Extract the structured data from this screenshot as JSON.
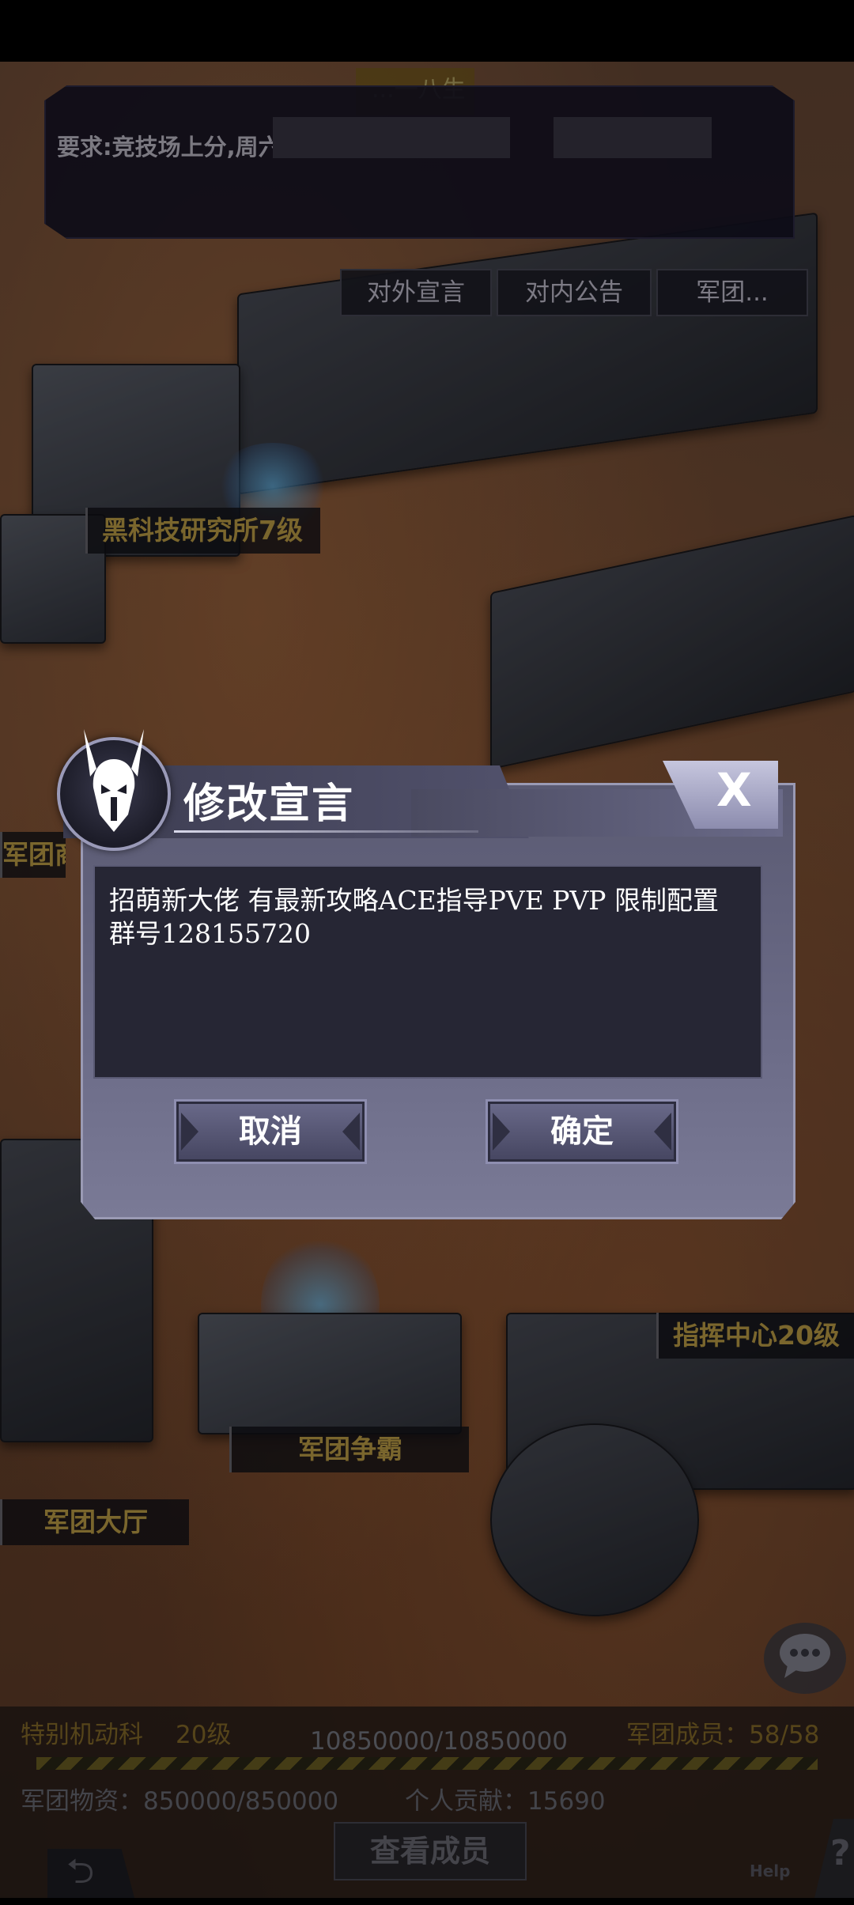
{
  "top_panel": {
    "title_fragment": "...一八生",
    "requirement": "要求:竞技场上分,周六"
  },
  "tabs": [
    "对外宣言",
    "对内公告",
    "军团..."
  ],
  "map_labels": {
    "lab": "黑科技研究所7级",
    "shop": "军团商",
    "command_center": "指挥中心20级",
    "contest": "军团争霸",
    "hall": "军团大厅"
  },
  "dialog": {
    "title": "修改宣言",
    "close_label": "X",
    "declaration_text": "招萌新大佬 有最新攻略ACE指导PVE PVP 限制配置\n群号128155720",
    "cancel_label": "取消",
    "confirm_label": "确定"
  },
  "bottom_info": {
    "unit_name": "特别机动科",
    "level": "20级",
    "members": "军团成员：58/58",
    "experience": "10850000/10850000",
    "supplies": "军团物资：850000/850000",
    "contribution": "个人贡献：15690",
    "view_members_label": "查看成员",
    "help_label": "Help",
    "help_glyph": "?",
    "back_glyph": "⮌"
  },
  "progress": {
    "experience_fraction": 1.0
  },
  "icons": [
    "emblem-icon",
    "close-icon",
    "chat-icon",
    "back-icon",
    "help-icon"
  ]
}
